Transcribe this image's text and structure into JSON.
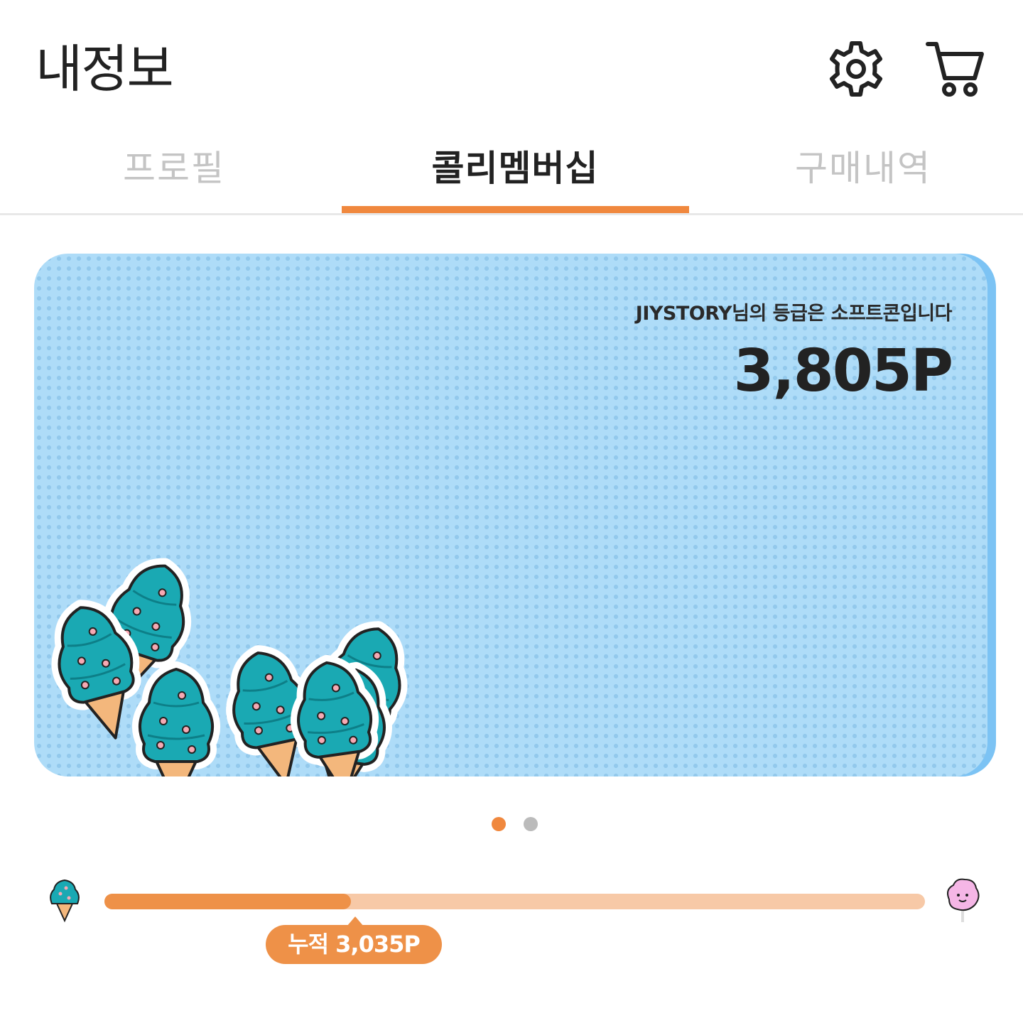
{
  "header": {
    "title": "내정보",
    "icons": [
      "gear-icon",
      "cart-icon"
    ]
  },
  "tabs": [
    {
      "label": "프로필",
      "active": false
    },
    {
      "label": "콜리멤버십",
      "active": true
    },
    {
      "label": "구매내역",
      "active": false
    }
  ],
  "card": {
    "grade_text": "JIYSTORY님의 등급은 소프트콘입니다",
    "points": "3,805P"
  },
  "carousel": {
    "pages": 2,
    "current": 1
  },
  "progress": {
    "label": "누적 3,035P",
    "fraction": 0.3
  },
  "colors": {
    "accent": "#f0883e",
    "card_bg": "#aedcf8",
    "track": "#f7c9a7"
  }
}
